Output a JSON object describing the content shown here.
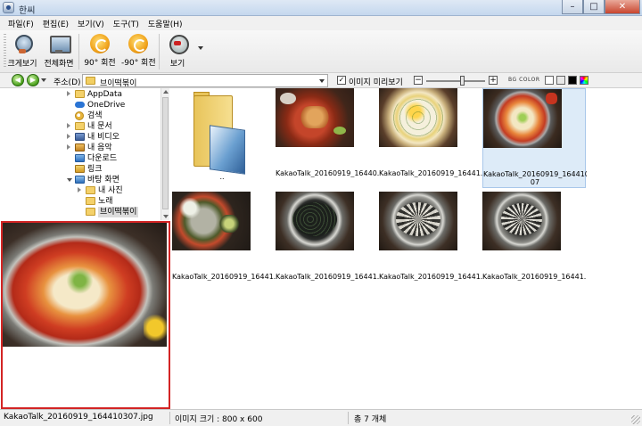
{
  "window": {
    "title": "한씨"
  },
  "menu": [
    "파일(F)",
    "편집(E)",
    "보기(V)",
    "도구(T)",
    "도움말(H)"
  ],
  "toolbar": {
    "zoom_view": "크게보기",
    "fullscreen": "전체화면",
    "rotate_cw": "90° 회전",
    "rotate_ccw": "-90° 회전",
    "view": "보기"
  },
  "address": {
    "label": "주소(D)",
    "value": "브이떡볶이",
    "preview_checkbox_label": "이미지 미리보기",
    "preview_checked": true,
    "zoom_level": 0.6,
    "bg_color_label": "BG COLOR",
    "bg_swatches": [
      "#ffffff",
      "#e8e8e8",
      "#000000",
      "rainbow"
    ]
  },
  "tree": {
    "items": [
      {
        "label": "AppData",
        "icon": "folder-icon",
        "expand": "closed"
      },
      {
        "label": "OneDrive",
        "icon": "cloud-icon",
        "expand": "none"
      },
      {
        "label": "검색",
        "icon": "search-icon",
        "expand": "none"
      },
      {
        "label": "내 문서",
        "icon": "documents-icon",
        "expand": "closed"
      },
      {
        "label": "내 비디오",
        "icon": "video-icon",
        "expand": "closed"
      },
      {
        "label": "내 음악",
        "icon": "music-icon",
        "expand": "closed"
      },
      {
        "label": "다운로드",
        "icon": "download-icon",
        "expand": "none"
      },
      {
        "label": "링크",
        "icon": "link-icon",
        "expand": "none"
      },
      {
        "label": "바탕 화면",
        "icon": "desktop-icon",
        "expand": "open"
      },
      {
        "label": "내 사진",
        "icon": "folder-icon",
        "expand": "closed"
      },
      {
        "label": "노래",
        "icon": "folder-icon",
        "expand": "none"
      },
      {
        "label": "브이떡볶이",
        "icon": "folder-icon",
        "expand": "none",
        "selected": true
      }
    ]
  },
  "thumbnails": [
    {
      "caption": "..",
      "type": "folder"
    },
    {
      "caption": "KakaoTalk_20160919_16440...",
      "type": "image"
    },
    {
      "caption": "KakaoTalk_20160919_16441...",
      "type": "image"
    },
    {
      "caption": "KakaoTalk_20160919_1644103\n07",
      "type": "image",
      "selected": true
    },
    {
      "caption": "KakaoTalk_20160919_16441...",
      "type": "image"
    },
    {
      "caption": "KakaoTalk_20160919_16441...",
      "type": "image"
    },
    {
      "caption": "KakaoTalk_20160919_16441...",
      "type": "image"
    },
    {
      "caption": "KakaoTalk_20160919_16441...",
      "type": "image"
    }
  ],
  "status": {
    "filename": "KakaoTalk_20160919_164410307.jpg",
    "image_size": "이미지 크기 : 800 x 600",
    "total": "총 7 개체"
  }
}
